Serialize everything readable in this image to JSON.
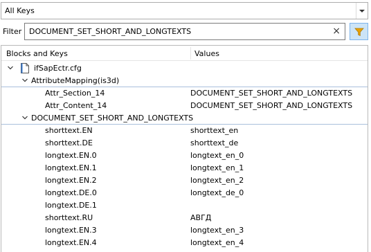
{
  "dropdown": {
    "selected": "All Keys"
  },
  "filter": {
    "label": "Filter",
    "value": "DOCUMENT_SET_SHORT_AND_LONGTEXTS",
    "clear_symbol": "×"
  },
  "columns": {
    "keys": "Blocks and Keys",
    "values": "Values"
  },
  "tree": {
    "file": {
      "name": "ifSapEctr.cfg"
    },
    "block1": {
      "name": "AttributeMapping(is3d)",
      "rows": [
        {
          "key": "Attr_Section_14",
          "value": "DOCUMENT_SET_SHORT_AND_LONGTEXTS"
        },
        {
          "key": "Attr_Content_14",
          "value": "DOCUMENT_SET_SHORT_AND_LONGTEXTS"
        }
      ]
    },
    "block2": {
      "name": "DOCUMENT_SET_SHORT_AND_LONGTEXTS",
      "rows": [
        {
          "key": "shorttext.EN",
          "value": "shorttext_en"
        },
        {
          "key": "shorttext.DE",
          "value": "shorttext_de"
        },
        {
          "key": "longtext.EN.0",
          "value": "longtext_en_0"
        },
        {
          "key": "longtext.EN.1",
          "value": "longtext_en_1"
        },
        {
          "key": "longtext.EN.2",
          "value": "longtext_en_2"
        },
        {
          "key": "longtext.DE.0",
          "value": "longtext_de_0"
        },
        {
          "key": "longtext.DE.1",
          "value": ""
        },
        {
          "key": "shorttext.RU",
          "value": "АВГД"
        },
        {
          "key": "longtext.EN.3",
          "value": "longtext_en_3"
        },
        {
          "key": "longtext.EN.4",
          "value": "longtext_en_4"
        }
      ]
    }
  },
  "colors": {
    "funnel": "#e8a100",
    "group_underline": "#a9bfdc",
    "filter_button_bg": "#cce4f7"
  }
}
